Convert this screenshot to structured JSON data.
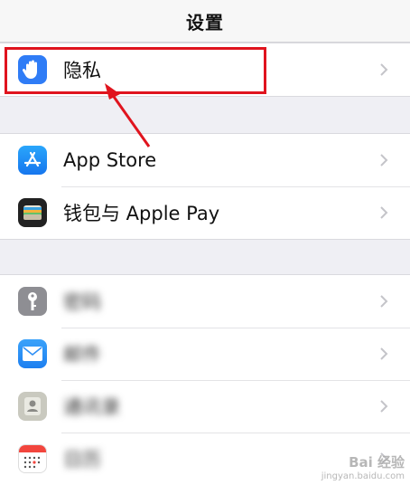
{
  "navbar": {
    "title": "设置"
  },
  "groups": [
    {
      "rows": [
        {
          "label": "隐私",
          "icon": "privacy-hand-icon",
          "color": "#2f7cf6"
        }
      ]
    },
    {
      "rows": [
        {
          "label": "App Store",
          "icon": "app-store-icon",
          "color": "#1b8ef7"
        },
        {
          "label": "钱包与 Apple Pay",
          "icon": "wallet-icon",
          "color": "#222222"
        }
      ]
    },
    {
      "rows": [
        {
          "label": "密码",
          "icon": "key-icon",
          "color": "#8e8e93"
        },
        {
          "label": "邮件",
          "icon": "mail-icon",
          "color": "#2e8ff5"
        },
        {
          "label": "通讯录",
          "icon": "contacts-icon",
          "color": "#b8b8ac"
        },
        {
          "label": "日历",
          "icon": "calendar-icon",
          "color": "#ffffff"
        }
      ]
    }
  ],
  "annotation": {
    "box_color": "#e0141e",
    "arrow_color": "#e0141e"
  },
  "watermark": {
    "line1": "Bai 经验",
    "line2": "jingyan.baidu.com"
  }
}
